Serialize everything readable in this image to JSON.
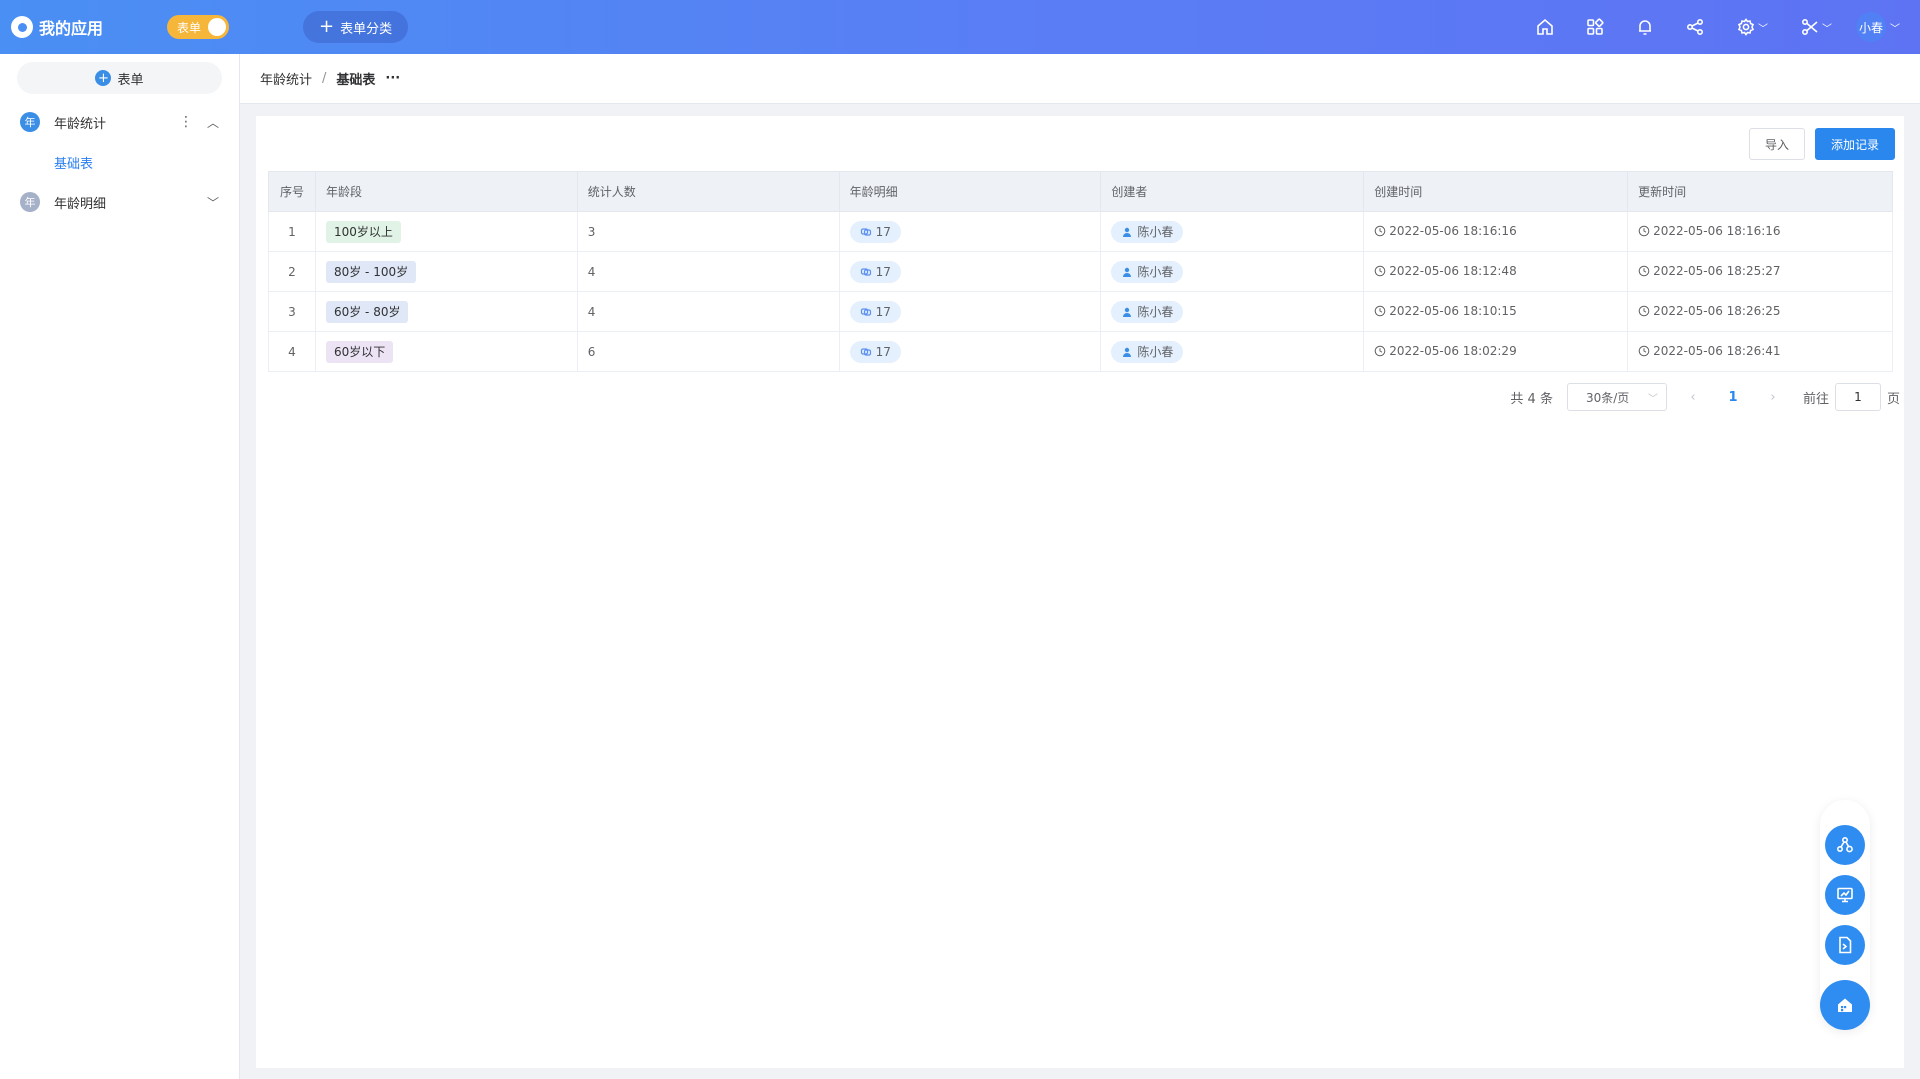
{
  "app": {
    "title": "我的应用",
    "mode_label": "表单",
    "category_button": "表单分类",
    "user_name": "小春"
  },
  "sidebar": {
    "add_label": "表单",
    "groups": [
      {
        "badge": "年",
        "label": "年龄统计",
        "color": "#3a8ee6",
        "expanded": true,
        "items": [
          {
            "label": "基础表"
          }
        ]
      },
      {
        "badge": "年",
        "label": "年龄明细",
        "color": "#a4b1c8",
        "expanded": false,
        "items": []
      }
    ]
  },
  "breadcrumb": {
    "parent": "年龄统计",
    "separator": "/",
    "current": "基础表",
    "more": "···"
  },
  "toolbar": {
    "import_label": "导入",
    "add_label": "添加记录"
  },
  "table": {
    "columns": [
      "序号",
      "年龄段",
      "统计人数",
      "年龄明细",
      "创建者",
      "创建时间",
      "更新时间"
    ],
    "rows": [
      {
        "idx": "1",
        "range": "100岁以上",
        "tag_color": "#e1f3e7",
        "count": "3",
        "detail": "17",
        "creator": "陈小春",
        "created": "2022-05-06 18:16:16",
        "updated": "2022-05-06 18:16:16"
      },
      {
        "idx": "2",
        "range": "80岁 - 100岁",
        "tag_color": "#e0e8f7",
        "count": "4",
        "detail": "17",
        "creator": "陈小春",
        "created": "2022-05-06 18:12:48",
        "updated": "2022-05-06 18:25:27"
      },
      {
        "idx": "3",
        "range": "60岁 - 80岁",
        "tag_color": "#e0e8f7",
        "count": "4",
        "detail": "17",
        "creator": "陈小春",
        "created": "2022-05-06 18:10:15",
        "updated": "2022-05-06 18:26:25"
      },
      {
        "idx": "4",
        "range": "60岁以下",
        "tag_color": "#ece3f5",
        "count": "6",
        "detail": "17",
        "creator": "陈小春",
        "created": "2022-05-06 18:02:29",
        "updated": "2022-05-06 18:26:41"
      }
    ]
  },
  "pagination": {
    "total": "共 4 条",
    "page_size": "30条/页",
    "current_page": "1",
    "goto_label": "前往",
    "goto_value": "1",
    "page_suffix": "页"
  },
  "colors": {
    "accent": "#2a87ee",
    "topbar": "#4a8ff3",
    "toggle": "#f5b63a"
  }
}
